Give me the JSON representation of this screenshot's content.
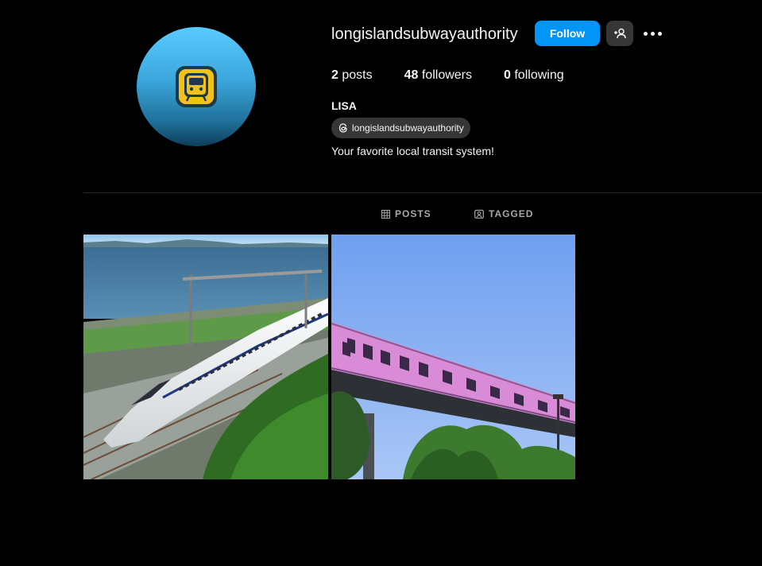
{
  "profile": {
    "username": "longislandsubwayauthority",
    "full_name": "LISA",
    "threads_handle": "longislandsubwayauthority",
    "bio": "Your favorite local transit system!"
  },
  "buttons": {
    "follow": "Follow"
  },
  "stats": {
    "posts_count": "2",
    "posts_label": "posts",
    "followers_count": "48",
    "followers_label": "followers",
    "following_count": "0",
    "following_label": "following"
  },
  "tabs": [
    {
      "label": "POSTS",
      "icon": "grid-icon"
    },
    {
      "label": "TAGGED",
      "icon": "tagged-icon"
    }
  ],
  "colors": {
    "accent": "#0095f6",
    "background": "#000000",
    "avatar_top": "#5bcbff",
    "logo_yellow": "#f2c21b"
  }
}
